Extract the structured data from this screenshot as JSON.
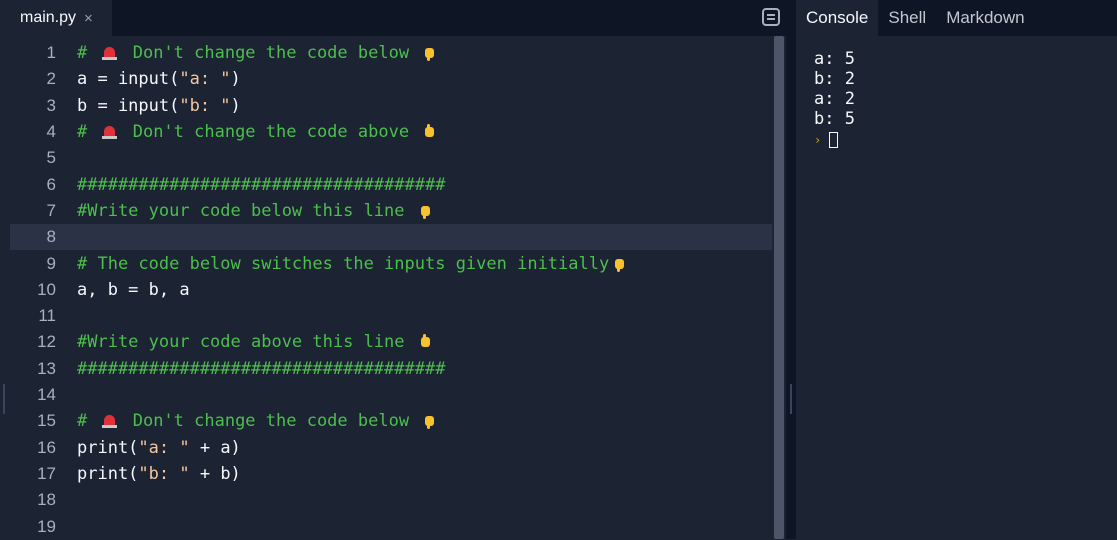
{
  "editor": {
    "file_tab": "main.py",
    "close_glyph": "×",
    "lines": [
      {
        "n": "1",
        "parts": [
          {
            "t": "# ",
            "c": "comment"
          },
          {
            "e": "alert"
          },
          {
            "t": " Don't change the code below ",
            "c": "comment"
          },
          {
            "e": "hand-down"
          }
        ]
      },
      {
        "n": "2",
        "parts": [
          {
            "t": "a = input(",
            "c": "plain"
          },
          {
            "t": "\"a: \"",
            "c": "str"
          },
          {
            "t": ")",
            "c": "plain"
          }
        ]
      },
      {
        "n": "3",
        "parts": [
          {
            "t": "b = input(",
            "c": "plain"
          },
          {
            "t": "\"b: \"",
            "c": "str"
          },
          {
            "t": ")",
            "c": "plain"
          }
        ]
      },
      {
        "n": "4",
        "parts": [
          {
            "t": "# ",
            "c": "comment"
          },
          {
            "e": "alert"
          },
          {
            "t": " Don't change the code above ",
            "c": "comment"
          },
          {
            "e": "hand-up"
          }
        ]
      },
      {
        "n": "5",
        "parts": []
      },
      {
        "n": "6",
        "parts": [
          {
            "t": "####################################",
            "c": "comment"
          }
        ]
      },
      {
        "n": "7",
        "parts": [
          {
            "t": "#Write your code below this line ",
            "c": "comment"
          },
          {
            "e": "hand-down"
          }
        ]
      },
      {
        "n": "8",
        "parts": [],
        "active": true
      },
      {
        "n": "9",
        "parts": [
          {
            "t": "# The code below switches the inputs given initially",
            "c": "comment"
          },
          {
            "e": "hand-down"
          }
        ]
      },
      {
        "n": "10",
        "parts": [
          {
            "t": "a, b = b, a",
            "c": "plain"
          }
        ]
      },
      {
        "n": "11",
        "parts": []
      },
      {
        "n": "12",
        "parts": [
          {
            "t": "#Write your code above this line ",
            "c": "comment"
          },
          {
            "e": "hand-up"
          }
        ]
      },
      {
        "n": "13",
        "parts": [
          {
            "t": "####################################",
            "c": "comment"
          }
        ]
      },
      {
        "n": "14",
        "parts": []
      },
      {
        "n": "15",
        "parts": [
          {
            "t": "# ",
            "c": "comment"
          },
          {
            "e": "alert"
          },
          {
            "t": " Don't change the code below ",
            "c": "comment"
          },
          {
            "e": "hand-down"
          }
        ]
      },
      {
        "n": "16",
        "parts": [
          {
            "t": "print(",
            "c": "plain"
          },
          {
            "t": "\"a: \"",
            "c": "str"
          },
          {
            "t": " + a)",
            "c": "plain"
          }
        ]
      },
      {
        "n": "17",
        "parts": [
          {
            "t": "print(",
            "c": "plain"
          },
          {
            "t": "\"b: \"",
            "c": "str"
          },
          {
            "t": " + b)",
            "c": "plain"
          }
        ]
      },
      {
        "n": "18",
        "parts": []
      },
      {
        "n": "19",
        "parts": []
      }
    ]
  },
  "console": {
    "tabs": [
      {
        "label": "Console",
        "active": true
      },
      {
        "label": "Shell",
        "active": false
      },
      {
        "label": "Markdown",
        "active": false
      }
    ],
    "output": [
      "a: 5",
      "b: 2",
      "a: 2",
      "b: 5"
    ],
    "prompt_glyph": "›"
  },
  "colors": {
    "background": "#1c2333",
    "tab_bar": "#0e1525",
    "comment": "#4cbf4c",
    "string": "#f5c7a0",
    "text": "#f5f9fc"
  }
}
